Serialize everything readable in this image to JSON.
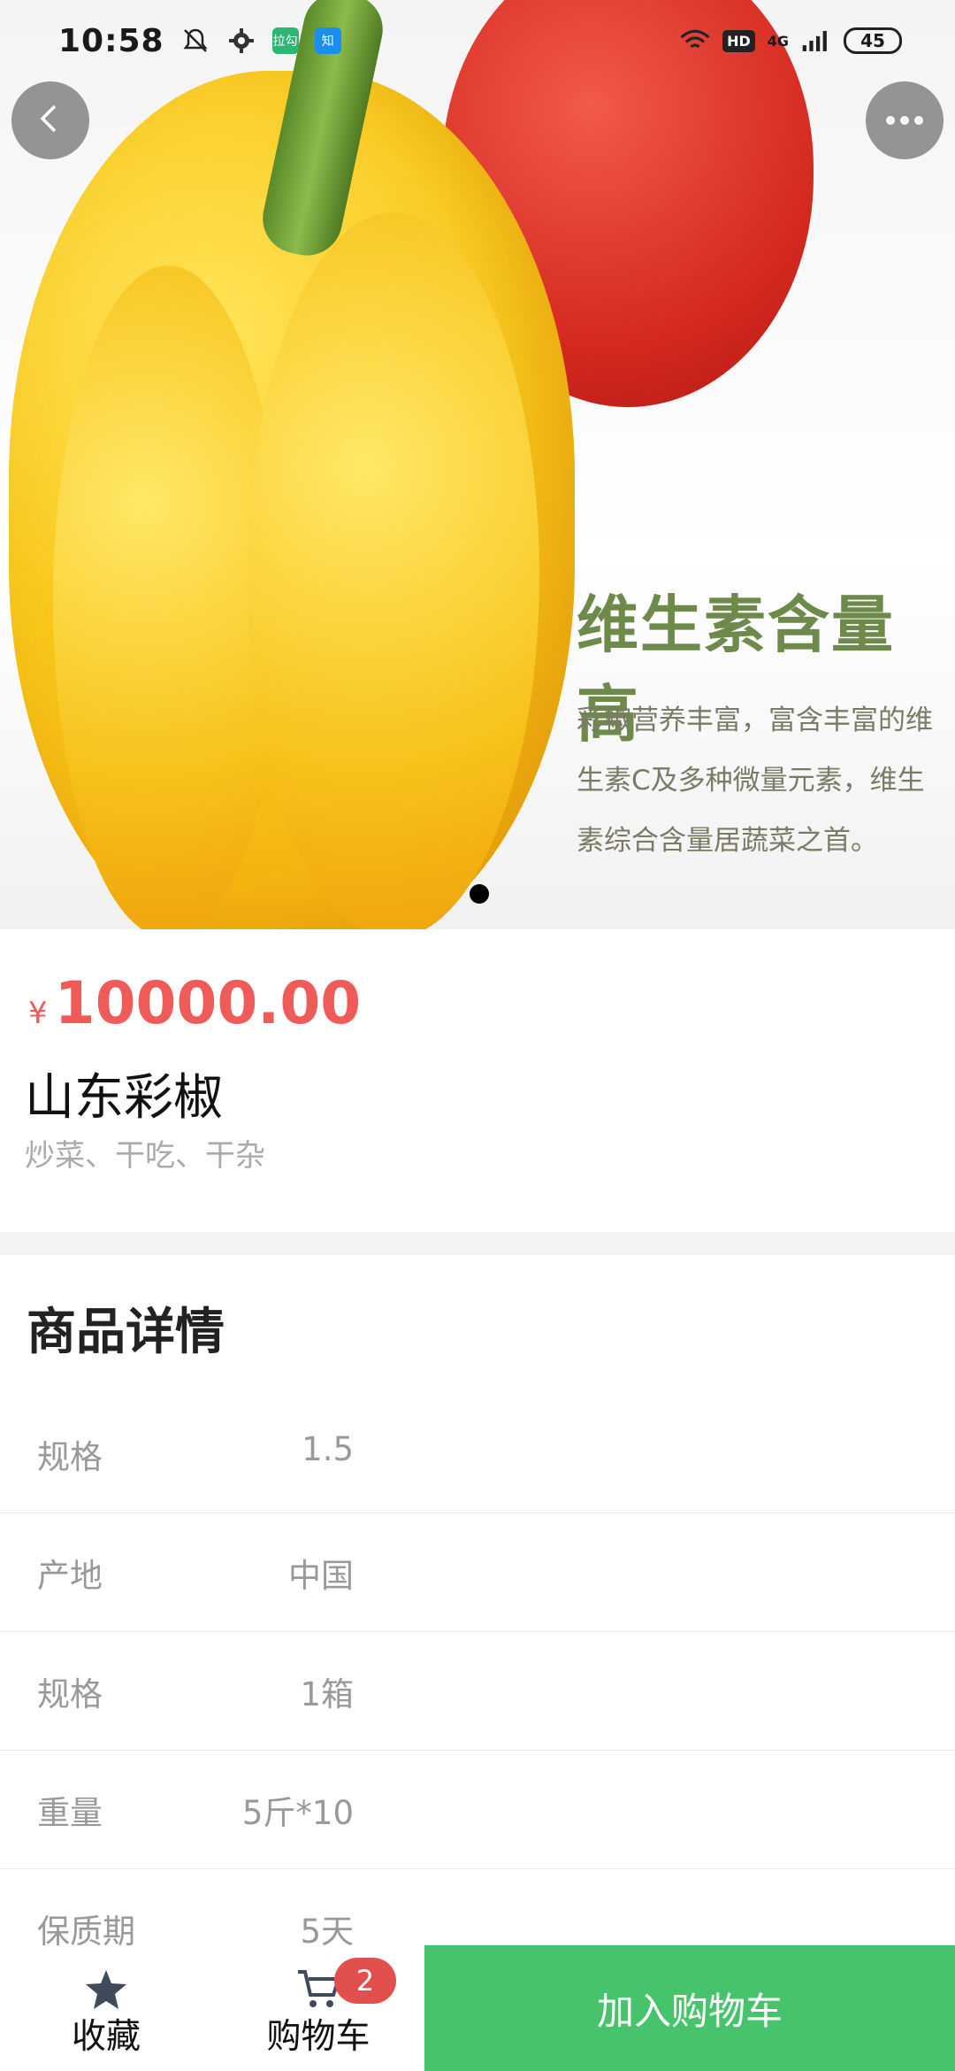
{
  "status_bar": {
    "time": "10:58",
    "network": "4G",
    "hd_label": "HD",
    "battery": "45",
    "app_icon_1": "拉勾",
    "app_icon_2": "知"
  },
  "banner": {
    "headline": "维生素含量高",
    "description": "彩椒营养丰富，富含丰富的维生素C及多种微量元素，维生素综合含量居蔬菜之首。",
    "current_slide": 1
  },
  "product": {
    "currency": "¥",
    "price": "10000.00",
    "name": "山东彩椒",
    "tags": "炒菜、干吃、干杂"
  },
  "details": {
    "title": "商品详情",
    "specs": [
      {
        "key": "规格",
        "value": "1.5"
      },
      {
        "key": "产地",
        "value": "中国"
      },
      {
        "key": "规格",
        "value": "1箱"
      },
      {
        "key": "重量",
        "value": "5斤*10"
      },
      {
        "key": "保质期",
        "value": "5天"
      }
    ]
  },
  "bottom_bar": {
    "favorite_label": "收藏",
    "cart_label": "购物车",
    "cart_count": "2",
    "add_to_cart_label": "加入购物车"
  },
  "colors": {
    "accent_green": "#47c36b",
    "price_red": "#ef5b59",
    "badge_red": "#e2504d"
  }
}
